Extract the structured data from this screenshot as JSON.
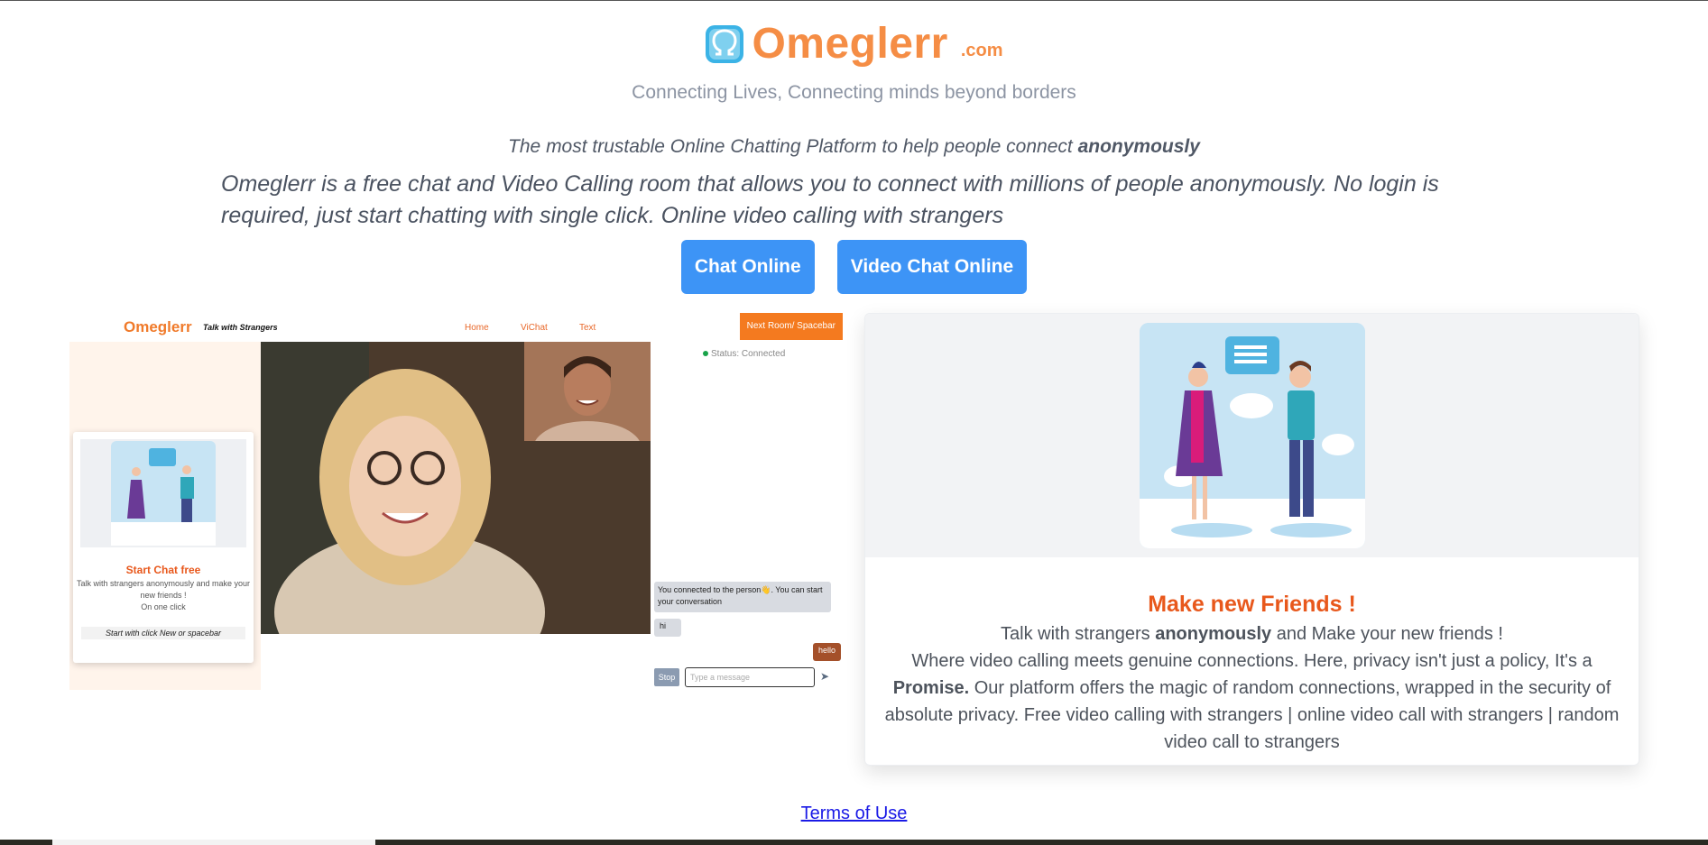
{
  "brand": {
    "name": "Omeglerr",
    "suffix": ".com"
  },
  "tagline": "Connecting Lives, Connecting minds beyond borders",
  "trust": {
    "text": "The most trustable Online Chatting Platform to help people connect",
    "emphasis": "anonymously"
  },
  "description": "Omeglerr is a free chat and Video Calling room that allows you to connect with millions of people anonymously. No login is required, just start chatting with single click. Online video calling with strangers",
  "cta": {
    "chat": "Chat Online",
    "video": "Video Chat Online"
  },
  "mock": {
    "brand": "Omeglerr",
    "slogan": "Talk with Strangers",
    "nav": [
      "Home",
      "ViChat",
      "Text"
    ],
    "next": "Next Room/ Spacebar",
    "card_title": "Start Chat free",
    "card_text": "Talk with strangers anonymously and make your new friends !",
    "card_text2": "On one click",
    "card_button": "Start with click New or spacebar",
    "status": "Status: Connected",
    "system_msg": "You connected to the person👋. You can start your conversation",
    "msg_in": "hi",
    "msg_out": "hello",
    "stop": "Stop",
    "input_placeholder": "Type a message"
  },
  "feature": {
    "title": "Make new Friends !",
    "line1_a": "Talk with strangers",
    "line1_b": "anonymously",
    "line1_c": "and Make your new friends !",
    "para_a": "Where video calling meets genuine connections. Here, privacy isn't just a policy, It's a",
    "para_b": "Promise.",
    "para_c": "Our platform offers the magic of random connections, wrapped in the security of absolute privacy. Free video calling with strangers | online video call with strangers | random video call to strangers"
  },
  "footer": {
    "terms": "Terms of Use"
  },
  "colors": {
    "orange": "#f58d45",
    "accent": "#e8581c",
    "button": "#3d94f6"
  },
  "icons": [
    "omegle-logo-icon",
    "send-icon",
    "status-dot-icon"
  ]
}
